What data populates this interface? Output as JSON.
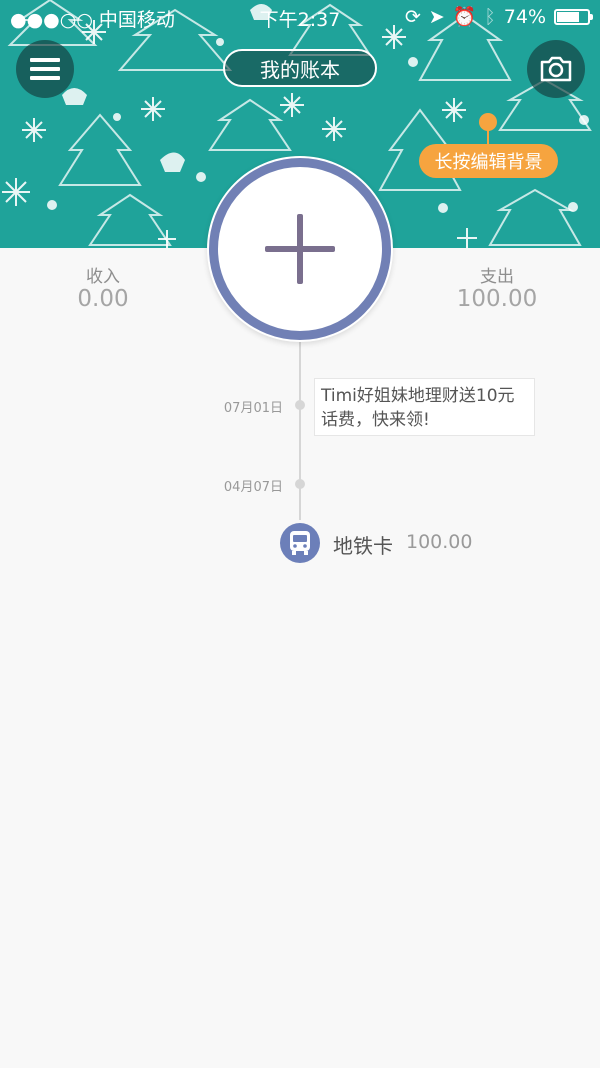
{
  "status_bar": {
    "carrier": "●●●○○ 中国移动",
    "time": "下午2:37",
    "battery": "74%",
    "battery_level": 0.74
  },
  "header": {
    "title": "我的账本",
    "edit_background_tip": "长按编辑背景",
    "menu_icon": "hamburger-menu-icon",
    "camera_icon": "camera-icon",
    "background_color": "#1fa39a"
  },
  "summary": {
    "income_label": "收入",
    "income_value": "0.00",
    "expense_label": "支出",
    "expense_value": "100.00"
  },
  "timeline": {
    "entries": [
      {
        "date": "07月01日",
        "promo_line1": "Timi好姐妹",
        "promo_line1b": "地理财送10元",
        "promo_line2": "话费，快来领!"
      },
      {
        "date": "04月07日",
        "name": "地铁卡",
        "amount": "100.00",
        "icon": "bus-icon"
      }
    ]
  },
  "colors": {
    "accent": "#7180b5",
    "orange": "#f6a43f",
    "teal": "#1fa39a"
  }
}
